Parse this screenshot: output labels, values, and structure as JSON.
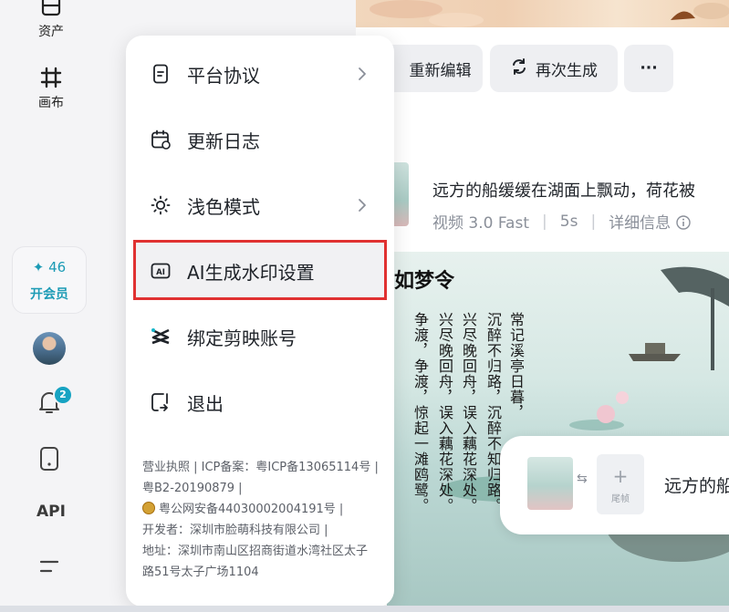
{
  "sidebar": {
    "assets_label": "资产",
    "canvas_label": "画布",
    "vip": {
      "points": "✦ 46",
      "join_label": "开会员"
    },
    "notification_count": "2",
    "api_label": "API"
  },
  "toolbar": {
    "reedit_label": "重新编辑",
    "regenerate_label": "再次生成",
    "more_label": "···"
  },
  "result": {
    "prompt": "远方的船缓缓在湖面上飘动，荷花被",
    "model": "视频 3.0 Fast",
    "duration": "5s",
    "details_label": "详细信息"
  },
  "painting": {
    "title": "如梦令",
    "columns": [
      "常记溪亭日暮，",
      "沉醉不归路，沉醉不知归路。",
      "兴尽晚回舟，误入藕花深处。",
      "兴尽晚回舟，误入藕花深处。",
      "争渡，争渡，惊起一滩鸥鹭。"
    ]
  },
  "float_card": {
    "tail_frame_label": "尾帧",
    "prompt_preview": "远方的船"
  },
  "menu": {
    "items": [
      {
        "label": "平台协议",
        "icon": "document-icon",
        "has_submenu": true
      },
      {
        "label": "更新日志",
        "icon": "calendar-icon",
        "has_submenu": false
      },
      {
        "label": "浅色模式",
        "icon": "sun-icon",
        "has_submenu": true
      },
      {
        "label": "AI生成水印设置",
        "icon": "ai-badge-icon",
        "has_submenu": false
      },
      {
        "label": "绑定剪映账号",
        "icon": "capcut-icon",
        "has_submenu": false
      },
      {
        "label": "退出",
        "icon": "logout-icon",
        "has_submenu": false
      }
    ],
    "footer": {
      "line1": "营业执照 | ICP备案：粤ICP备13065114号 |",
      "line2": "粤B2-20190879 |",
      "line3": "粤公网安备44030002004191号 |",
      "line4": "开发者：深圳市脸萌科技有限公司 |",
      "line5": "地址：深圳市南山区招商街道水湾社区太子",
      "line6": "路51号太子广场1104"
    }
  },
  "colors": {
    "accent": "#1c9bb5",
    "highlight_border": "#e03131"
  }
}
